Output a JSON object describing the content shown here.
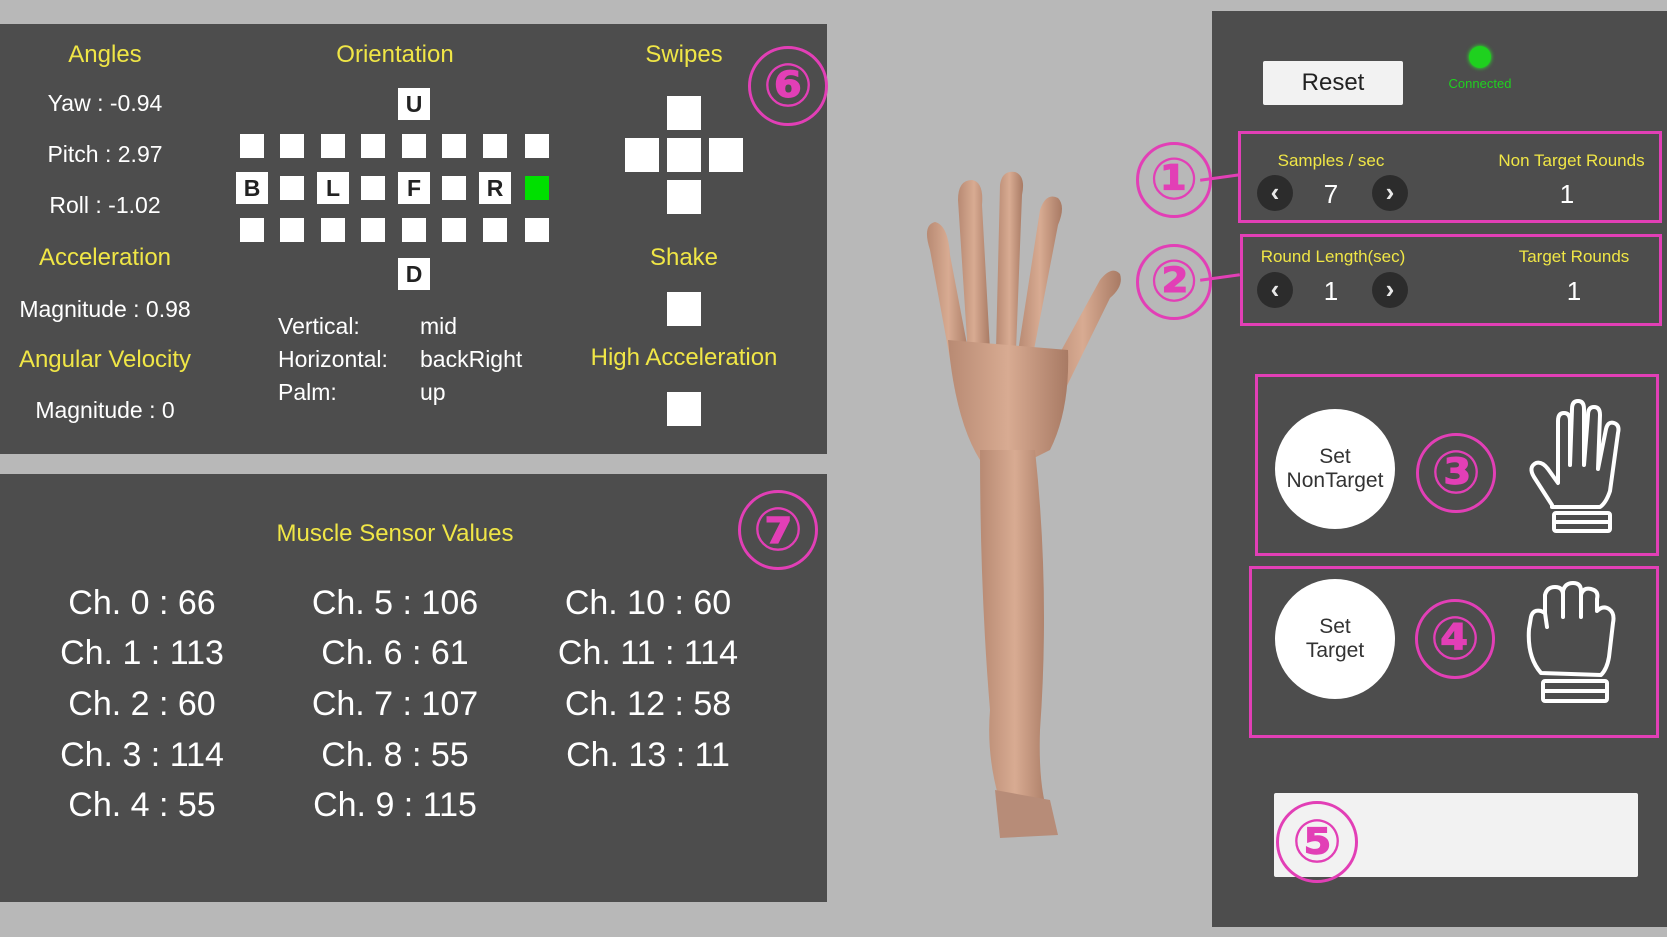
{
  "sensor_panel": {
    "angles": {
      "title": "Angles",
      "yaw": "Yaw : -0.94",
      "pitch": "Pitch : 2.97",
      "roll": "Roll : -1.02"
    },
    "acceleration": {
      "title": "Acceleration",
      "magnitude": "Magnitude : 0.98"
    },
    "angular_velocity": {
      "title": "Angular Velocity",
      "magnitude": "Magnitude : 0"
    },
    "orientation": {
      "title": "Orientation",
      "labels": {
        "up": "U",
        "down": "D",
        "back": "B",
        "left": "L",
        "front": "F",
        "right": "R"
      },
      "active_color": "#00e000",
      "vertical_label": "Vertical:",
      "vertical_value": "mid",
      "horizontal_label": "Horizontal:",
      "horizontal_value": "backRight",
      "palm_label": "Palm:",
      "palm_value": "up"
    },
    "swipes_title": "Swipes",
    "shake_title": "Shake",
    "high_accel_title": "High Acceleration",
    "marker": "⑥"
  },
  "muscle_panel": {
    "title": "Muscle Sensor Values",
    "marker": "⑦",
    "channels": [
      "Ch. 0 : 66",
      "Ch. 1 : 113",
      "Ch. 2 : 60",
      "Ch. 3 : 114",
      "Ch. 4 : 55",
      "Ch. 5 : 106",
      "Ch. 6 : 61",
      "Ch. 7 : 107",
      "Ch. 8 : 55",
      "Ch. 9 : 115",
      "Ch. 10 : 60",
      "Ch. 11 : 114",
      "Ch. 12 : 58",
      "Ch. 13 : 11"
    ]
  },
  "control_panel": {
    "reset_label": "Reset",
    "connection_status": "Connected",
    "status_color": "#1fd11f",
    "samples_label": "Samples / sec",
    "samples_value": "7",
    "non_target_rounds_label": "Non Target Rounds",
    "non_target_rounds_value": "1",
    "round_length_label": "Round Length(sec)",
    "round_length_value": "1",
    "target_rounds_label": "Target Rounds",
    "target_rounds_value": "1",
    "prev_icon": "chevron-left-icon",
    "next_icon": "chevron-right-icon",
    "set_nontarget_line1": "Set",
    "set_nontarget_line2": "NonTarget",
    "set_target_line1": "Set",
    "set_target_line2": "Target",
    "text_field_value": "",
    "markers": [
      "①",
      "②",
      "③",
      "④",
      "⑤"
    ]
  },
  "colors": {
    "panel": "#4d4d4d",
    "background": "#b8b8b8",
    "heading": "#f0e646",
    "annotation": "#e23fb6"
  }
}
